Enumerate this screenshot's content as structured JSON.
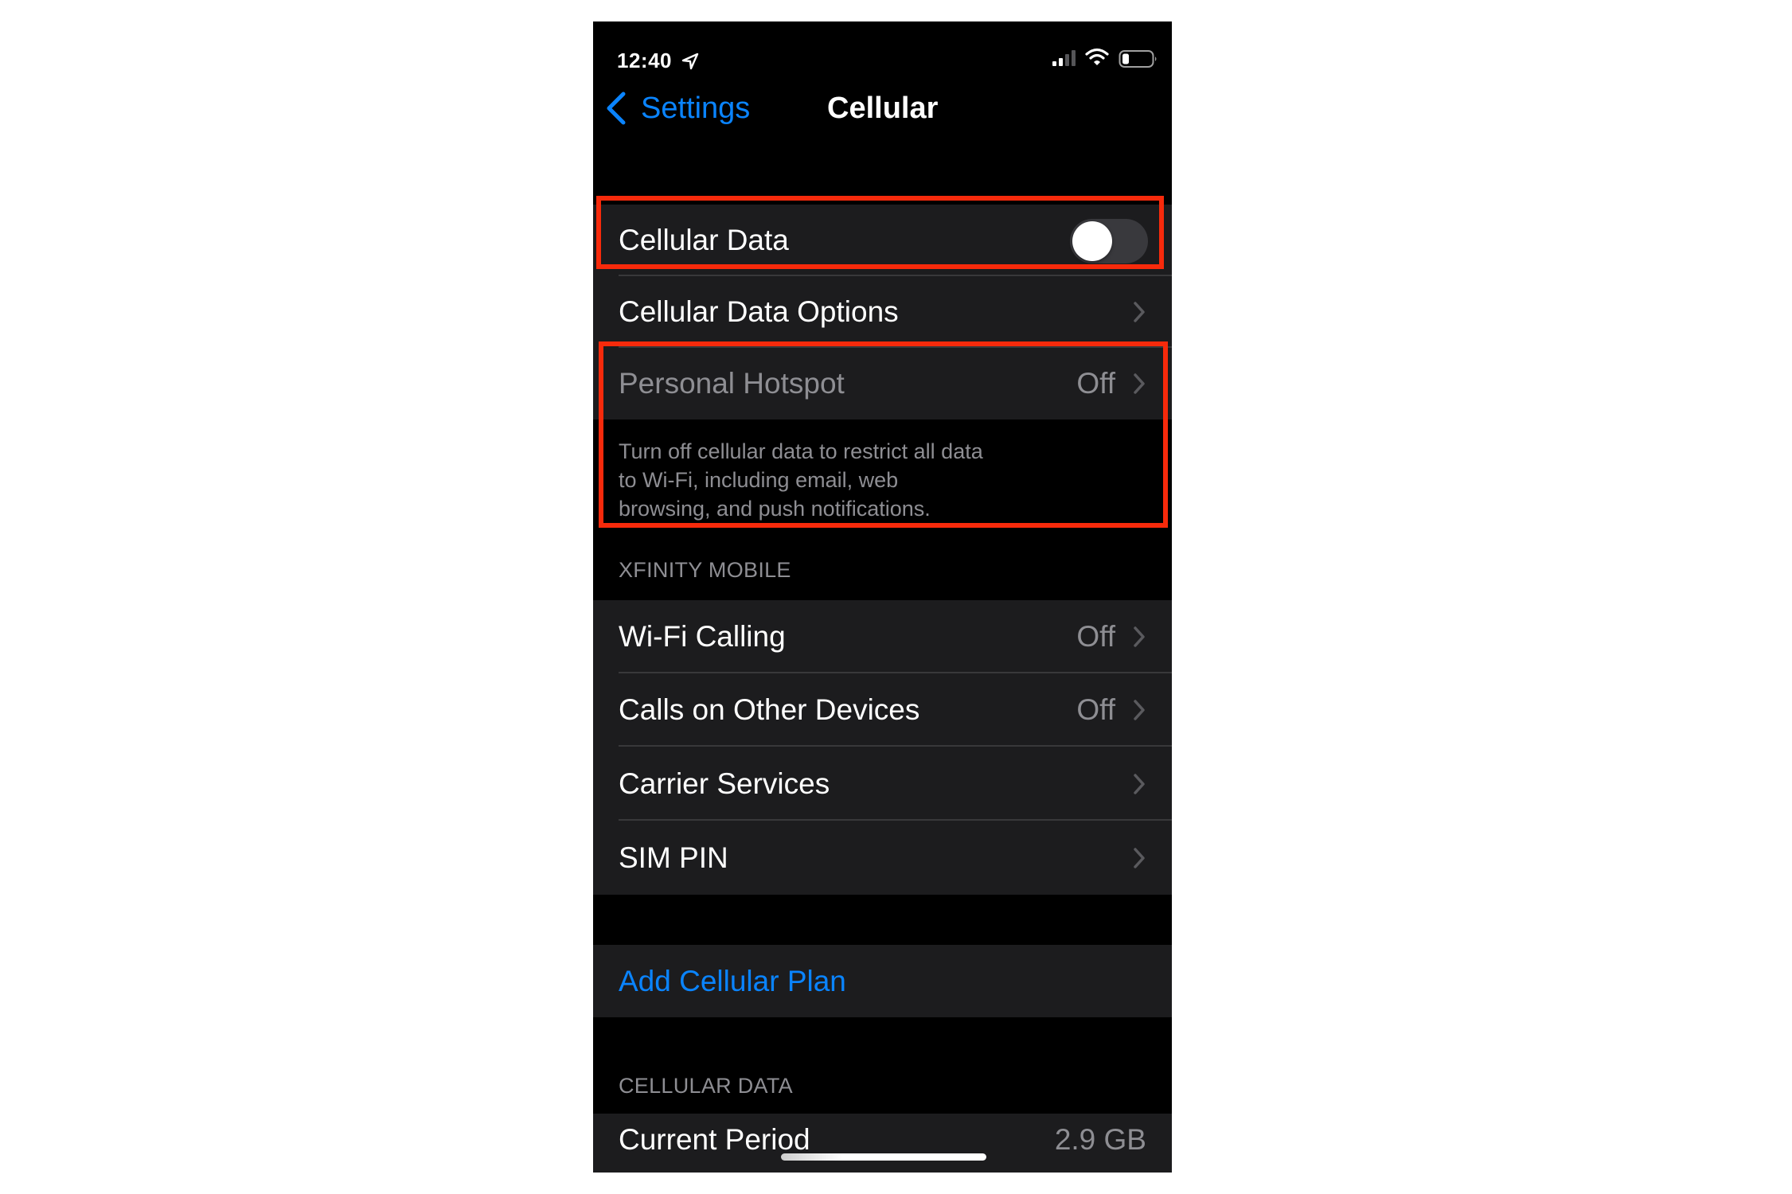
{
  "status_bar": {
    "time": "12:40",
    "icons": [
      "location-arrow-icon",
      "cellular-signal-icon",
      "wifi-icon",
      "battery-icon"
    ],
    "signal_bars_active": 2,
    "signal_bars_total": 4,
    "battery_level_fraction": 0.2
  },
  "nav": {
    "back_label": "Settings",
    "title": "Cellular"
  },
  "colors": {
    "accent": "#0a84ff",
    "highlight_box": "#f72a0b",
    "row_background": "#1c1c1e",
    "secondary_text": "#8e8e93"
  },
  "group_main": {
    "rows": [
      {
        "label": "Cellular Data",
        "control": "toggle",
        "toggle_on": false
      },
      {
        "label": "Cellular Data Options",
        "value": ""
      },
      {
        "label": "Personal Hotspot",
        "value": "Off",
        "disabled": true
      }
    ],
    "footer": "Turn off cellular data to restrict all data to Wi-Fi, including email, web browsing, and push notifications."
  },
  "group_carrier": {
    "header": "XFINITY MOBILE",
    "rows": [
      {
        "label": "Wi-Fi Calling",
        "value": "Off"
      },
      {
        "label": "Calls on Other Devices",
        "value": "Off"
      },
      {
        "label": "Carrier Services",
        "value": ""
      },
      {
        "label": "SIM PIN",
        "value": ""
      }
    ]
  },
  "group_plan": {
    "rows": [
      {
        "label": "Add Cellular Plan"
      }
    ]
  },
  "group_usage": {
    "header": "CELLULAR DATA",
    "rows": [
      {
        "label": "Current Period",
        "value": "2.9 GB"
      }
    ]
  },
  "annotations": {
    "highlight_boxes": [
      "cellular-data-row",
      "personal-hotspot-and-footer"
    ]
  }
}
